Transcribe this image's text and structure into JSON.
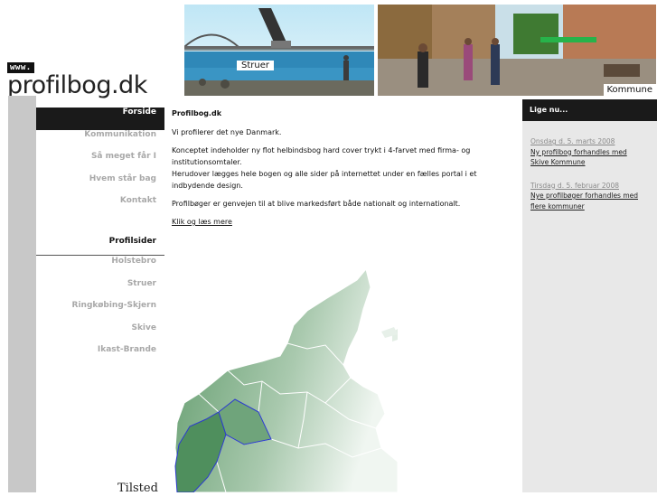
{
  "logo": {
    "prefix": "www.",
    "name": "profilbog.dk"
  },
  "header_photos": [
    {
      "caption": "Struer"
    },
    {
      "caption": "Kommune"
    }
  ],
  "nav": {
    "items": [
      {
        "label": "Forside",
        "active": true
      },
      {
        "label": "Kommunikation"
      },
      {
        "label": "Så meget får I"
      },
      {
        "label": "Hvem står bag"
      },
      {
        "label": "Kontakt"
      }
    ],
    "heading": "Profilsider",
    "profile_items": [
      {
        "label": "Holstebro"
      },
      {
        "label": "Struer"
      },
      {
        "label": "Ringkøbing-Skjern"
      },
      {
        "label": "Skive"
      },
      {
        "label": "Ikast-Brande"
      }
    ],
    "bottom_text": "Tilsted"
  },
  "main": {
    "title": "Profilbog.dk",
    "intro": "Vi profilerer det nye Danmark.",
    "paragraph1": "Konceptet indeholder ny flot helbindsbog hard cover trykt i 4-farvet med firma- og institutionsomtaler.",
    "paragraph1b": "Herudover lægges hele bogen og alle sider på internettet under en fælles portal i et indbydende design.",
    "paragraph2": "Profilbøger er genvejen til at blive markedsført både nationalt og internationalt.",
    "link": "Klik og læs mere"
  },
  "sidebar": {
    "heading": "Lige nu...",
    "news": [
      {
        "date": "Onsdag d. 5. marts 2008",
        "title": "Ny profilbog forhandles med Skive Kommune"
      },
      {
        "date": "Tirsdag d. 5. februar 2008",
        "title": "Nye profilbøger forhandles med flere kommuner"
      }
    ]
  },
  "colors": {
    "dark": "#1a1a1a",
    "nav_inactive": "#a8a8a8",
    "grey_strip": "#c8c8c8",
    "sidebar_bg": "#e8e8e8",
    "map_green": "#5f9a6a"
  }
}
